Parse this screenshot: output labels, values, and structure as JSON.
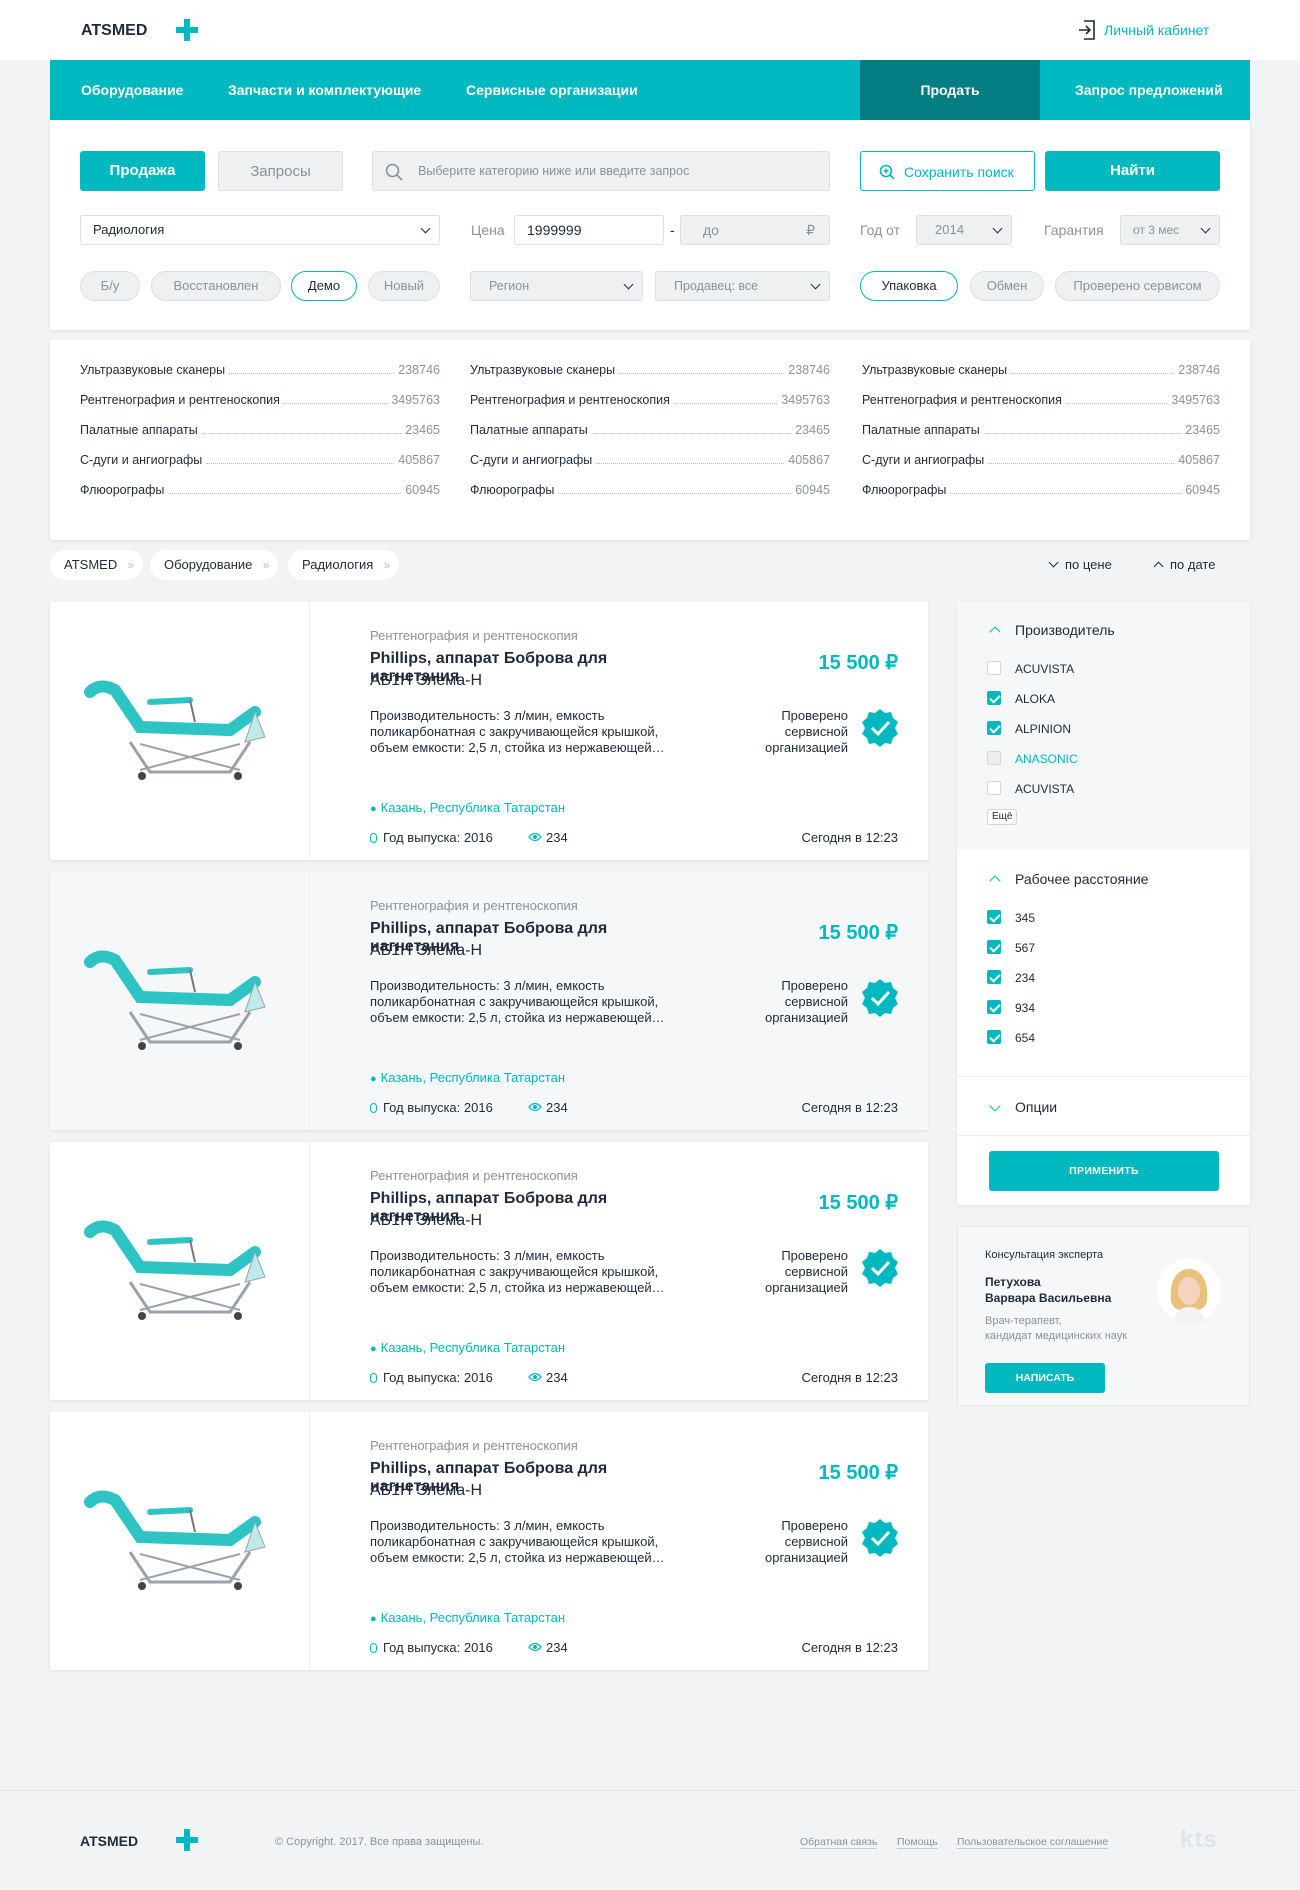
{
  "header": {
    "logo": "ATSMED",
    "account_link": "Личный кабинет"
  },
  "nav": {
    "items": [
      "Оборудование",
      "Запчасти и комплектующие",
      "Сервисные организации"
    ],
    "sell": "Продать",
    "request": "Запрос предложений"
  },
  "search": {
    "tab_sale": "Продажа",
    "tab_requests": "Запросы",
    "placeholder": "Выберите категорию ниже или введите запрос",
    "save": "Сохранить поиск",
    "find": "Найти",
    "category": "Радиология",
    "price_label": "Цена",
    "price_from": "1999999",
    "price_to_placeholder": "до",
    "currency": "₽",
    "year_label": "Год от",
    "year_value": "2014",
    "warranty_label": "Гарантия",
    "warranty_value": "от 3 мес",
    "conditions": [
      {
        "label": "Б/у",
        "active": false
      },
      {
        "label": "Восстановлен",
        "active": false
      },
      {
        "label": "Демо",
        "active": true
      },
      {
        "label": "Новый",
        "active": false
      }
    ],
    "region": "Регион",
    "seller": "Продавец: все",
    "options": [
      {
        "label": "Упаковка",
        "active": true
      },
      {
        "label": "Обмен",
        "active": false
      },
      {
        "label": "Проверено сервисом",
        "active": false
      }
    ]
  },
  "categories": [
    [
      {
        "name": "Ультразвуковые сканеры",
        "count": "238746"
      },
      {
        "name": "Рентгенография и рентгеноскопия",
        "count": "3495763"
      },
      {
        "name": "Палатные аппараты",
        "count": "23465"
      },
      {
        "name": "С-дуги и ангиографы",
        "count": "405867"
      },
      {
        "name": "Флюорографы",
        "count": "60945"
      }
    ],
    [
      {
        "name": "Ультразвуковые сканеры",
        "count": "238746"
      },
      {
        "name": "Рентгенография и рентгеноскопия",
        "count": "3495763"
      },
      {
        "name": "Палатные аппараты",
        "count": "23465"
      },
      {
        "name": "С-дуги и ангиографы",
        "count": "405867"
      },
      {
        "name": "Флюорографы",
        "count": "60945"
      }
    ],
    [
      {
        "name": "Ультразвуковые сканеры",
        "count": "238746"
      },
      {
        "name": "Рентгенография и рентгеноскопия",
        "count": "3495763"
      },
      {
        "name": "Палатные аппараты",
        "count": "23465"
      },
      {
        "name": "С-дуги и ангиографы",
        "count": "405867"
      },
      {
        "name": "Флюорографы",
        "count": "60945"
      }
    ]
  ],
  "breadcrumb": [
    "ATSMED",
    "Оборудование",
    "Радиология"
  ],
  "sort": {
    "by_price": "по цене",
    "by_date": "по дате"
  },
  "listings": [
    {
      "category": "Рентгенография и рентгеноскопия",
      "title": "Phillips, аппарат Боброва для нагнетания",
      "model": "АБ1Н Элема-Н",
      "desc": "Производительность: 3 л/мин, емкость поликарбонатная с закручивающейся крышкой, объем емкости: 2,5 л, стойка  из нержавеющей…",
      "price": "15 500 ₽",
      "verified": "Проверено сервисной организацией",
      "location": "Казань, Республика Татарстан",
      "year": "Год выпуска: 2016",
      "views": "234",
      "date": "Сегодня в 12:23"
    },
    {
      "category": "Рентгенография и рентгеноскопия",
      "title": "Phillips, аппарат Боброва для нагнетания",
      "model": "АБ1Н Элема-Н",
      "desc": "Производительность: 3 л/мин, емкость поликарбонатная с закручивающейся крышкой, объем емкости: 2,5 л, стойка  из нержавеющей…",
      "price": "15 500 ₽",
      "verified": "Проверено сервисной организацией",
      "location": "Казань, Республика Татарстан",
      "year": "Год выпуска: 2016",
      "views": "234",
      "date": "Сегодня в 12:23"
    },
    {
      "category": "Рентгенография и рентгеноскопия",
      "title": "Phillips, аппарат Боброва для нагнетания",
      "model": "АБ1Н Элема-Н",
      "desc": "Производительность: 3 л/мин, емкость поликарбонатная с закручивающейся крышкой, объем емкости: 2,5 л, стойка  из нержавеющей…",
      "price": "15 500 ₽",
      "verified": "Проверено сервисной организацией",
      "location": "Казань, Республика Татарстан",
      "year": "Год выпуска: 2016",
      "views": "234",
      "date": "Сегодня в 12:23"
    },
    {
      "category": "Рентгенография и рентгеноскопия",
      "title": "Phillips, аппарат Боброва для нагнетания",
      "model": "АБ1Н Элема-Н",
      "desc": "Производительность: 3 л/мин, емкость поликарбонатная с закручивающейся крышкой, объем емкости: 2,5 л, стойка  из нержавеющей…",
      "price": "15 500 ₽",
      "verified": "Проверено сервисной организацией",
      "location": "Казань, Республика Татарстан",
      "year": "Год выпуска: 2016",
      "views": "234",
      "date": "Сегодня в 12:23"
    }
  ],
  "filters": {
    "manufacturer_title": "Производитель",
    "manufacturers": [
      {
        "label": "ACUVISTA",
        "checked": false
      },
      {
        "label": "ALOKA",
        "checked": true
      },
      {
        "label": "ALPINION",
        "checked": true
      },
      {
        "label": "ANASONIC",
        "checked": false
      },
      {
        "label": "ACUVISTA",
        "checked": false
      }
    ],
    "more": "Ещё",
    "distance_title": "Рабочее расстояние",
    "distances": [
      {
        "label": "345",
        "checked": true
      },
      {
        "label": "567",
        "checked": true
      },
      {
        "label": "234",
        "checked": true
      },
      {
        "label": "934",
        "checked": true
      },
      {
        "label": "654",
        "checked": true
      }
    ],
    "options_title": "Опции",
    "apply": "ПРИМЕНИТЬ"
  },
  "expert": {
    "heading": "Консультация эксперта",
    "name_line1": "Петухова",
    "name_line2": "Варвара Васильевна",
    "role_line1": "Врач-терапевт,",
    "role_line2": "кандидат медицинских наук",
    "button": "НАПИСАТЬ"
  },
  "footer": {
    "logo": "ATSMED",
    "copyright": "© Copyright. 2017. Все права защищены.",
    "links": [
      "Обратная связь",
      "Помощь",
      "Пользовательское соглашение"
    ],
    "brand": "kts"
  }
}
